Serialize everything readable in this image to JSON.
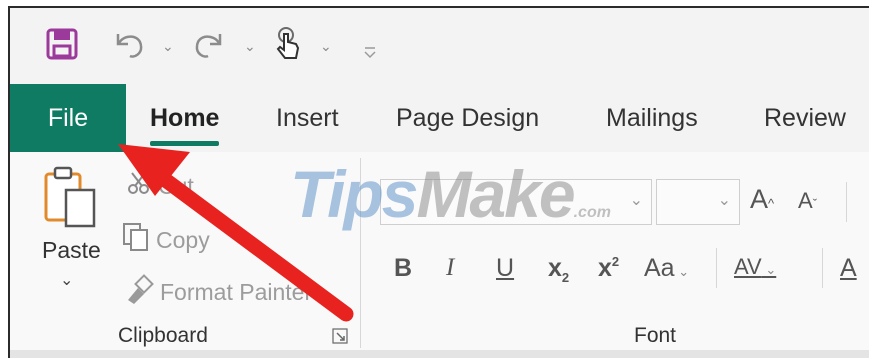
{
  "tabs": [
    "File",
    "Home",
    "Insert",
    "Page Design",
    "Mailings",
    "Review"
  ],
  "clipboard": {
    "paste_label": "Paste",
    "cut_label": "Cut",
    "copy_label": "Copy",
    "format_painter_label": "Format Painter",
    "group_label": "Clipboard"
  },
  "font": {
    "group_label": "Font",
    "grow_label": "A",
    "shrink_label": "A",
    "bold_label": "B",
    "italic_label": "I",
    "underline_label": "U",
    "subscript_label": "x",
    "superscript_label": "x",
    "subscript_mark": "2",
    "superscript_mark": "2",
    "change_case_label": "Aa",
    "char_spacing_label": "AV",
    "font_color_label": "A"
  },
  "watermark": {
    "tips": "Tips",
    "make": "Make",
    "dotcom": ".com"
  },
  "colors": {
    "accent": "#0f7b62",
    "save": "#9b3a9b",
    "arrow": "#e8221f"
  },
  "icons": [
    "save-icon",
    "undo-icon",
    "redo-icon",
    "touch-mode-icon",
    "customize-qat-icon",
    "paste-icon",
    "cut-icon",
    "copy-icon",
    "format-painter-icon"
  ]
}
